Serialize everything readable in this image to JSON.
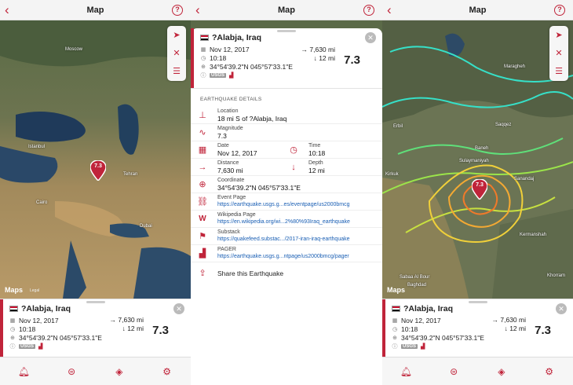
{
  "nav": {
    "back": "‹",
    "title": "Map",
    "help": "?"
  },
  "map1": {
    "cities": [
      "Moscow",
      "Istanbul",
      "Tehran",
      "Cairo",
      "Dubai"
    ],
    "pin": "7.3",
    "maps_label": " Maps",
    "legal": "Legal"
  },
  "map3": {
    "cities": [
      "Erbil",
      "Saqqez",
      "Kirkuk",
      "Sulaymaniyah",
      "Sanandaj",
      "Kermanshah",
      "Sabaa Al Bour",
      "Baghdad",
      "Khorram",
      "Maragheh",
      "Baneh"
    ],
    "pin": "7.3",
    "maps_label": " Maps"
  },
  "quake": {
    "title": "?Alabja, Iraq",
    "date": "Nov 12, 2017",
    "time": "10:18",
    "coord": "34°54'39.2\"N 045°57'33.1\"E",
    "source": "USGS",
    "distance": "→ 7,630 mi",
    "depth": "↓ 12 mi",
    "magnitude": "7.3",
    "close": "✕"
  },
  "details": {
    "section": "EARTHQUAKE DETAILS",
    "location_label": "Location",
    "location_value": "18 mi S of ?Alabja, Iraq",
    "magnitude_label": "Magnitude",
    "magnitude_value": "7.3",
    "date_label": "Date",
    "date_value": "Nov 12, 2017",
    "time_label": "Time",
    "time_value": "10:18",
    "distance_label": "Distance",
    "distance_value": "7,630 mi",
    "depth_label": "Depth",
    "depth_value": "12 mi",
    "coord_label": "Coordinate",
    "coord_value": "34°54'39.2\"N 045°57'33.1\"E",
    "event_label": "Event Page",
    "event_link": "https://earthquake.usgs.g...es/eventpage/us2000bmcg",
    "wiki_label": "Wikipedia Page",
    "wiki_link": "https://en.wikipedia.org/wi...2%80%93Iraq_earthquake",
    "substack_label": "Substack",
    "substack_link": "https://quakefeed.substac.../2017-iran-iraq-earthquake",
    "pager_label": "PAGER",
    "pager_link": "https://earthquake.usgs.g...ntpage/us2000bmcg/pager",
    "share": "Share this Earthquake"
  },
  "colors": {
    "accent": "#c0243a",
    "link": "#1a5fb4"
  }
}
